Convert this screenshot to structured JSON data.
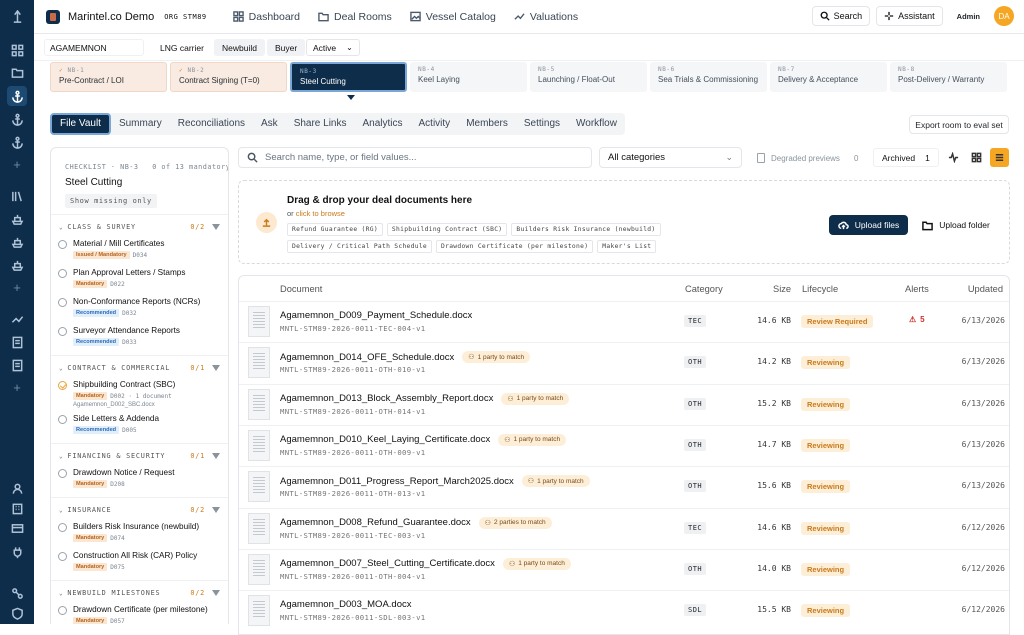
{
  "topbar": {
    "app_name": "Marintel.co Demo",
    "org": "ORG STM89",
    "nav": [
      "Dashboard",
      "Deal Rooms",
      "Vessel Catalog",
      "Valuations"
    ],
    "search_label": "Search",
    "assistant_label": "Assistant",
    "admin_label": "Admin",
    "avatar_initials": "DA"
  },
  "filterbar": {
    "vessel": "AGAMEMNON",
    "vessel_type": "LNG carrier",
    "build": "Newbuild",
    "role": "Buyer",
    "status": "Active"
  },
  "stages": [
    {
      "code": "NB-1",
      "name": "Pre-Contract / LOI",
      "state": "done"
    },
    {
      "code": "NB-2",
      "name": "Contract Signing (T=0)",
      "state": "done"
    },
    {
      "code": "NB-3",
      "name": "Steel Cutting",
      "state": "current"
    },
    {
      "code": "NB-4",
      "name": "Keel Laying",
      "state": "todo"
    },
    {
      "code": "NB-5",
      "name": "Launching / Float-Out",
      "state": "todo"
    },
    {
      "code": "NB-6",
      "name": "Sea Trials & Commissioning",
      "state": "todo"
    },
    {
      "code": "NB-7",
      "name": "Delivery & Acceptance",
      "state": "todo"
    },
    {
      "code": "NB-8",
      "name": "Post-Delivery / Warranty",
      "state": "todo"
    }
  ],
  "tabs": [
    "File Vault",
    "Summary",
    "Reconciliations",
    "Ask",
    "Share Links",
    "Analytics",
    "Activity",
    "Members",
    "Settings",
    "Workflow"
  ],
  "export_label": "Export room to eval set",
  "checklist": {
    "meta": "CHECKLIST · NB-3   0 of 13 mandatory",
    "title": "Steel Cutting",
    "show_missing": "Show missing only",
    "sections": [
      {
        "title": "CLASS & SURVEY",
        "count": "0/2",
        "items": [
          {
            "name": "Material / Mill Certificates",
            "tag": "Issued / Mandatory",
            "code": "D034",
            "tagtype": "iss"
          },
          {
            "name": "Plan Approval Letters / Stamps",
            "tag": "Mandatory",
            "code": "D022",
            "tagtype": "mand"
          },
          {
            "name": "Non-Conformance Reports (NCRs)",
            "tag": "Recommended",
            "code": "D032",
            "tagtype": "rec"
          },
          {
            "name": "Surveyor Attendance Reports",
            "tag": "Recommended",
            "code": "D033",
            "tagtype": "rec"
          }
        ]
      },
      {
        "title": "CONTRACT & COMMERCIAL",
        "count": "0/1",
        "items": [
          {
            "name": "Shipbuilding Contract (SBC)",
            "tag": "Mandatory",
            "code": "D002 · 1 document",
            "tagtype": "mand",
            "sub": "Agamemnon_D002_SBC.docx",
            "partial": true
          },
          {
            "name": "Side Letters & Addenda",
            "tag": "Recommended",
            "code": "D005",
            "tagtype": "rec"
          }
        ]
      },
      {
        "title": "FINANCING & SECURITY",
        "count": "0/1",
        "items": [
          {
            "name": "Drawdown Notice / Request",
            "tag": "Mandatory",
            "code": "D208",
            "tagtype": "mand"
          }
        ]
      },
      {
        "title": "INSURANCE",
        "count": "0/2",
        "items": [
          {
            "name": "Builders Risk Insurance (newbuild)",
            "tag": "Mandatory",
            "code": "D074",
            "tagtype": "mand"
          },
          {
            "name": "Construction All Risk (CAR) Policy",
            "tag": "Mandatory",
            "code": "D075",
            "tagtype": "mand"
          }
        ]
      },
      {
        "title": "NEWBUILD MILESTONES",
        "count": "0/2",
        "items": [
          {
            "name": "Drawdown Certificate (per milestone)",
            "tag": "Mandatory",
            "code": "D057",
            "tagtype": "mand"
          }
        ]
      }
    ]
  },
  "search": {
    "placeholder": "Search name, type, or field values..."
  },
  "category_select": "All categories",
  "degraded": {
    "label": "Degraded previews",
    "count": "0"
  },
  "archived": {
    "label": "Archived",
    "count": "1"
  },
  "dropzone": {
    "title": "Drag & drop your deal documents here",
    "or": "or",
    "browse": "click to browse",
    "chips": [
      "Refund Guarantee (RG)",
      "Shipbuilding Contract (SBC)",
      "Builders Risk Insurance (newbuild)",
      "Delivery / Critical Path Schedule",
      "Drawdown Certificate (per milestone)",
      "Maker's List"
    ],
    "upload_files": "Upload files",
    "upload_folder": "Upload folder"
  },
  "table": {
    "headers": {
      "document": "Document",
      "category": "Category",
      "size": "Size",
      "lifecycle": "Lifecycle",
      "alerts": "Alerts",
      "updated": "Updated"
    },
    "rows": [
      {
        "name": "Agamemnon_D009_Payment_Schedule.docx",
        "code": "MNTL-STM89-2026-0011-TEC-004-v1",
        "match": "",
        "category": "TEC",
        "size": "14.6 KB",
        "lifecycle": "Review Required",
        "alerts": "5",
        "updated": "6/13/2026"
      },
      {
        "name": "Agamemnon_D014_OFE_Schedule.docx",
        "code": "MNTL-STM89-2026-0011-OTH-010-v1",
        "match": "1 party to match",
        "category": "OTH",
        "size": "14.2 KB",
        "lifecycle": "Reviewing",
        "alerts": "",
        "updated": "6/13/2026"
      },
      {
        "name": "Agamemnon_D013_Block_Assembly_Report.docx",
        "code": "MNTL-STM89-2026-0011-OTH-014-v1",
        "match": "1 party to match",
        "category": "OTH",
        "size": "15.2 KB",
        "lifecycle": "Reviewing",
        "alerts": "",
        "updated": "6/13/2026"
      },
      {
        "name": "Agamemnon_D010_Keel_Laying_Certificate.docx",
        "code": "MNTL-STM89-2026-0011-OTH-009-v1",
        "match": "1 party to match",
        "category": "OTH",
        "size": "14.7 KB",
        "lifecycle": "Reviewing",
        "alerts": "",
        "updated": "6/13/2026"
      },
      {
        "name": "Agamemnon_D011_Progress_Report_March2025.docx",
        "code": "MNTL-STM89-2026-0011-OTH-013-v1",
        "match": "1 party to match",
        "category": "OTH",
        "size": "15.6 KB",
        "lifecycle": "Reviewing",
        "alerts": "",
        "updated": "6/13/2026"
      },
      {
        "name": "Agamemnon_D008_Refund_Guarantee.docx",
        "code": "MNTL-STM89-2026-0011-TEC-003-v1",
        "match": "2 parties to match",
        "category": "TEC",
        "size": "14.6 KB",
        "lifecycle": "Reviewing",
        "alerts": "",
        "updated": "6/12/2026"
      },
      {
        "name": "Agamemnon_D007_Steel_Cutting_Certificate.docx",
        "code": "MNTL-STM89-2026-0011-OTH-004-v1",
        "match": "1 party to match",
        "category": "OTH",
        "size": "14.0 KB",
        "lifecycle": "Reviewing",
        "alerts": "",
        "updated": "6/12/2026"
      },
      {
        "name": "Agamemnon_D003_MOA.docx",
        "code": "MNTL-STM89-2026-0011-SDL-003-v1",
        "match": "",
        "category": "SDL",
        "size": "15.5 KB",
        "lifecycle": "Reviewing",
        "alerts": "",
        "updated": "6/12/2026"
      }
    ]
  }
}
